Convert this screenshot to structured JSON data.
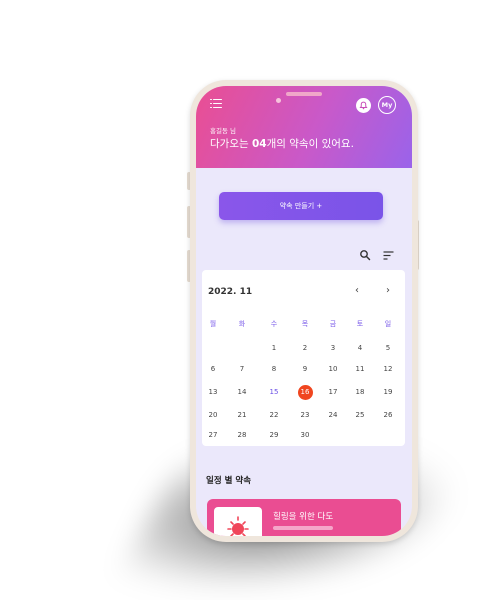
{
  "header": {
    "user_name": "홍길동 님",
    "headline_prefix": "다가오는 ",
    "headline_count": "04",
    "headline_suffix": "개의 약속이 있어요.",
    "profile_label": "My"
  },
  "actions": {
    "make_appointment": "약속 만들기 +"
  },
  "calendar": {
    "title": "2022. 11",
    "prev": "‹",
    "next": "›",
    "weekdays": [
      "월",
      "화",
      "수",
      "목",
      "금",
      "토",
      "일"
    ],
    "weeks": [
      [
        "",
        "",
        "1",
        "2",
        "3",
        "4",
        "5"
      ],
      [
        "6",
        "7",
        "8",
        "9",
        "10",
        "11",
        "12"
      ],
      [
        "13",
        "14",
        "15",
        "16",
        "17",
        "18",
        "19"
      ],
      [
        "20",
        "21",
        "22",
        "23",
        "24",
        "25",
        "26"
      ],
      [
        "27",
        "28",
        "29",
        "30",
        "",
        "",
        ""
      ]
    ],
    "highlighted_day": "15",
    "selected_day": "16",
    "accent_color": "#f0461f"
  },
  "schedule": {
    "section_title": "일정 별 약속",
    "cards": [
      {
        "title": "힐링을 위한 다도",
        "icon": "sun-icon"
      }
    ]
  },
  "colors": {
    "header_gradient": [
      "#ea4e92",
      "#9a63ea"
    ],
    "button": "#8a56ea",
    "card": "#ea4d92"
  }
}
